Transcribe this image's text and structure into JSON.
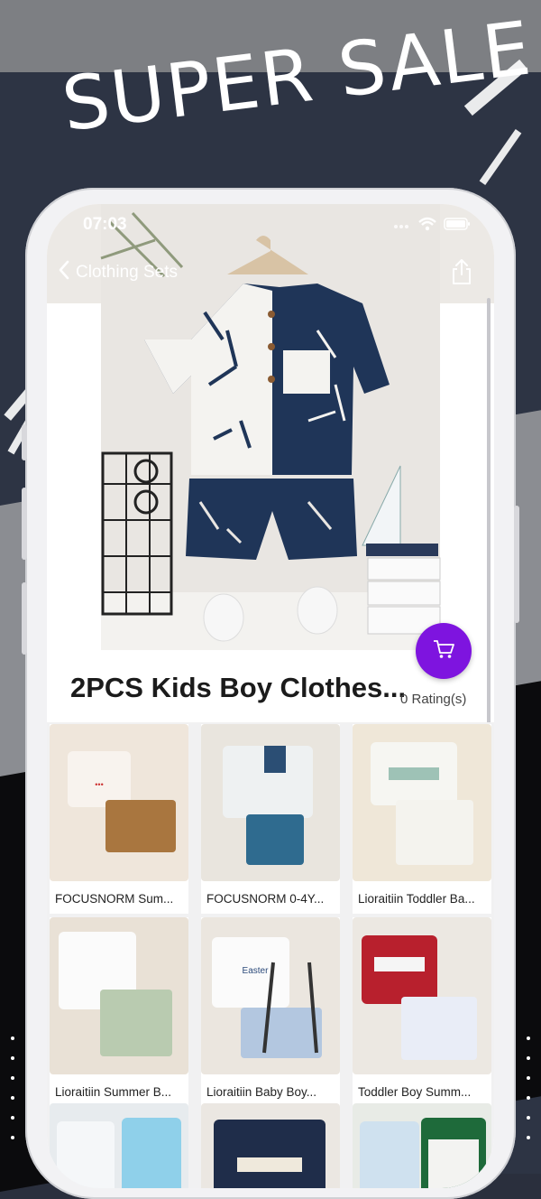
{
  "banner": {
    "title": "SUPER SALE"
  },
  "status_bar": {
    "time": "07:03"
  },
  "nav": {
    "back_label": "Clothing Sets"
  },
  "product": {
    "title": "2PCS Kids Boy Clothes...",
    "rating": "0 Rating(s)"
  },
  "related": [
    {
      "name": "FOCUSNORM Sum..."
    },
    {
      "name": "FOCUSNORM 0-4Y..."
    },
    {
      "name": "Lioraitiin Toddler Ba..."
    },
    {
      "name": "Lioraitiin Summer B..."
    },
    {
      "name": "Lioraitiin Baby Boy..."
    },
    {
      "name": "Toddler Boy Summ..."
    },
    {
      "name": ""
    },
    {
      "name": ""
    },
    {
      "name": ""
    }
  ],
  "colors": {
    "accent": "#7e14df",
    "navy_shirt": "#1f3558",
    "banner_bg": "#2d3444"
  },
  "icons": [
    "chevron-left-icon",
    "share-icon",
    "cart-icon",
    "wifi-icon",
    "battery-icon",
    "signal-icon"
  ]
}
